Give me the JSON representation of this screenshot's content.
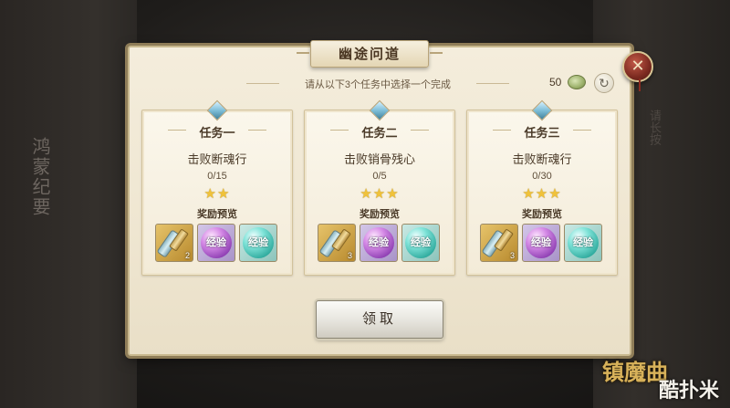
{
  "background": {
    "side_title": "鸿蒙纪要",
    "right_text": "请长按"
  },
  "dialog": {
    "title": "幽途问道",
    "instruction": "请从以下3个任务中选择一个完成",
    "currency_count": "50",
    "currency_icon": "jade-coin-icon",
    "refresh_icon": "refresh-icon",
    "close_icon": "close-icon",
    "claim_label": "领取"
  },
  "tasks": [
    {
      "label": "任务一",
      "name": "击败断魂行",
      "progress": "0/15",
      "stars": "★★",
      "star_count": 2,
      "reward_label": "奖励预览",
      "rewards": [
        {
          "type": "item",
          "icon": "scroll-icon",
          "qty": "2"
        },
        {
          "type": "exp",
          "label": "经验",
          "color": "#a64ad0"
        },
        {
          "type": "exp",
          "label": "经验",
          "color": "#2aa79a"
        }
      ]
    },
    {
      "label": "任务二",
      "name": "击败销骨残心",
      "progress": "0/5",
      "stars": "★★★",
      "star_count": 3,
      "reward_label": "奖励预览",
      "rewards": [
        {
          "type": "item",
          "icon": "scroll-icon",
          "qty": "3"
        },
        {
          "type": "exp",
          "label": "经验",
          "color": "#a64ad0"
        },
        {
          "type": "exp",
          "label": "经验",
          "color": "#2aa79a"
        }
      ]
    },
    {
      "label": "任务三",
      "name": "击败断魂行",
      "progress": "0/30",
      "stars": "★★★",
      "star_count": 3,
      "reward_label": "奖励预览",
      "rewards": [
        {
          "type": "item",
          "icon": "scroll-icon",
          "qty": "3"
        },
        {
          "type": "exp",
          "label": "经验",
          "color": "#a64ad0"
        },
        {
          "type": "exp",
          "label": "经验",
          "color": "#2aa79a"
        }
      ]
    }
  ],
  "watermark": {
    "game_logo": "镇魔曲",
    "site_logo": "酷扑米"
  }
}
